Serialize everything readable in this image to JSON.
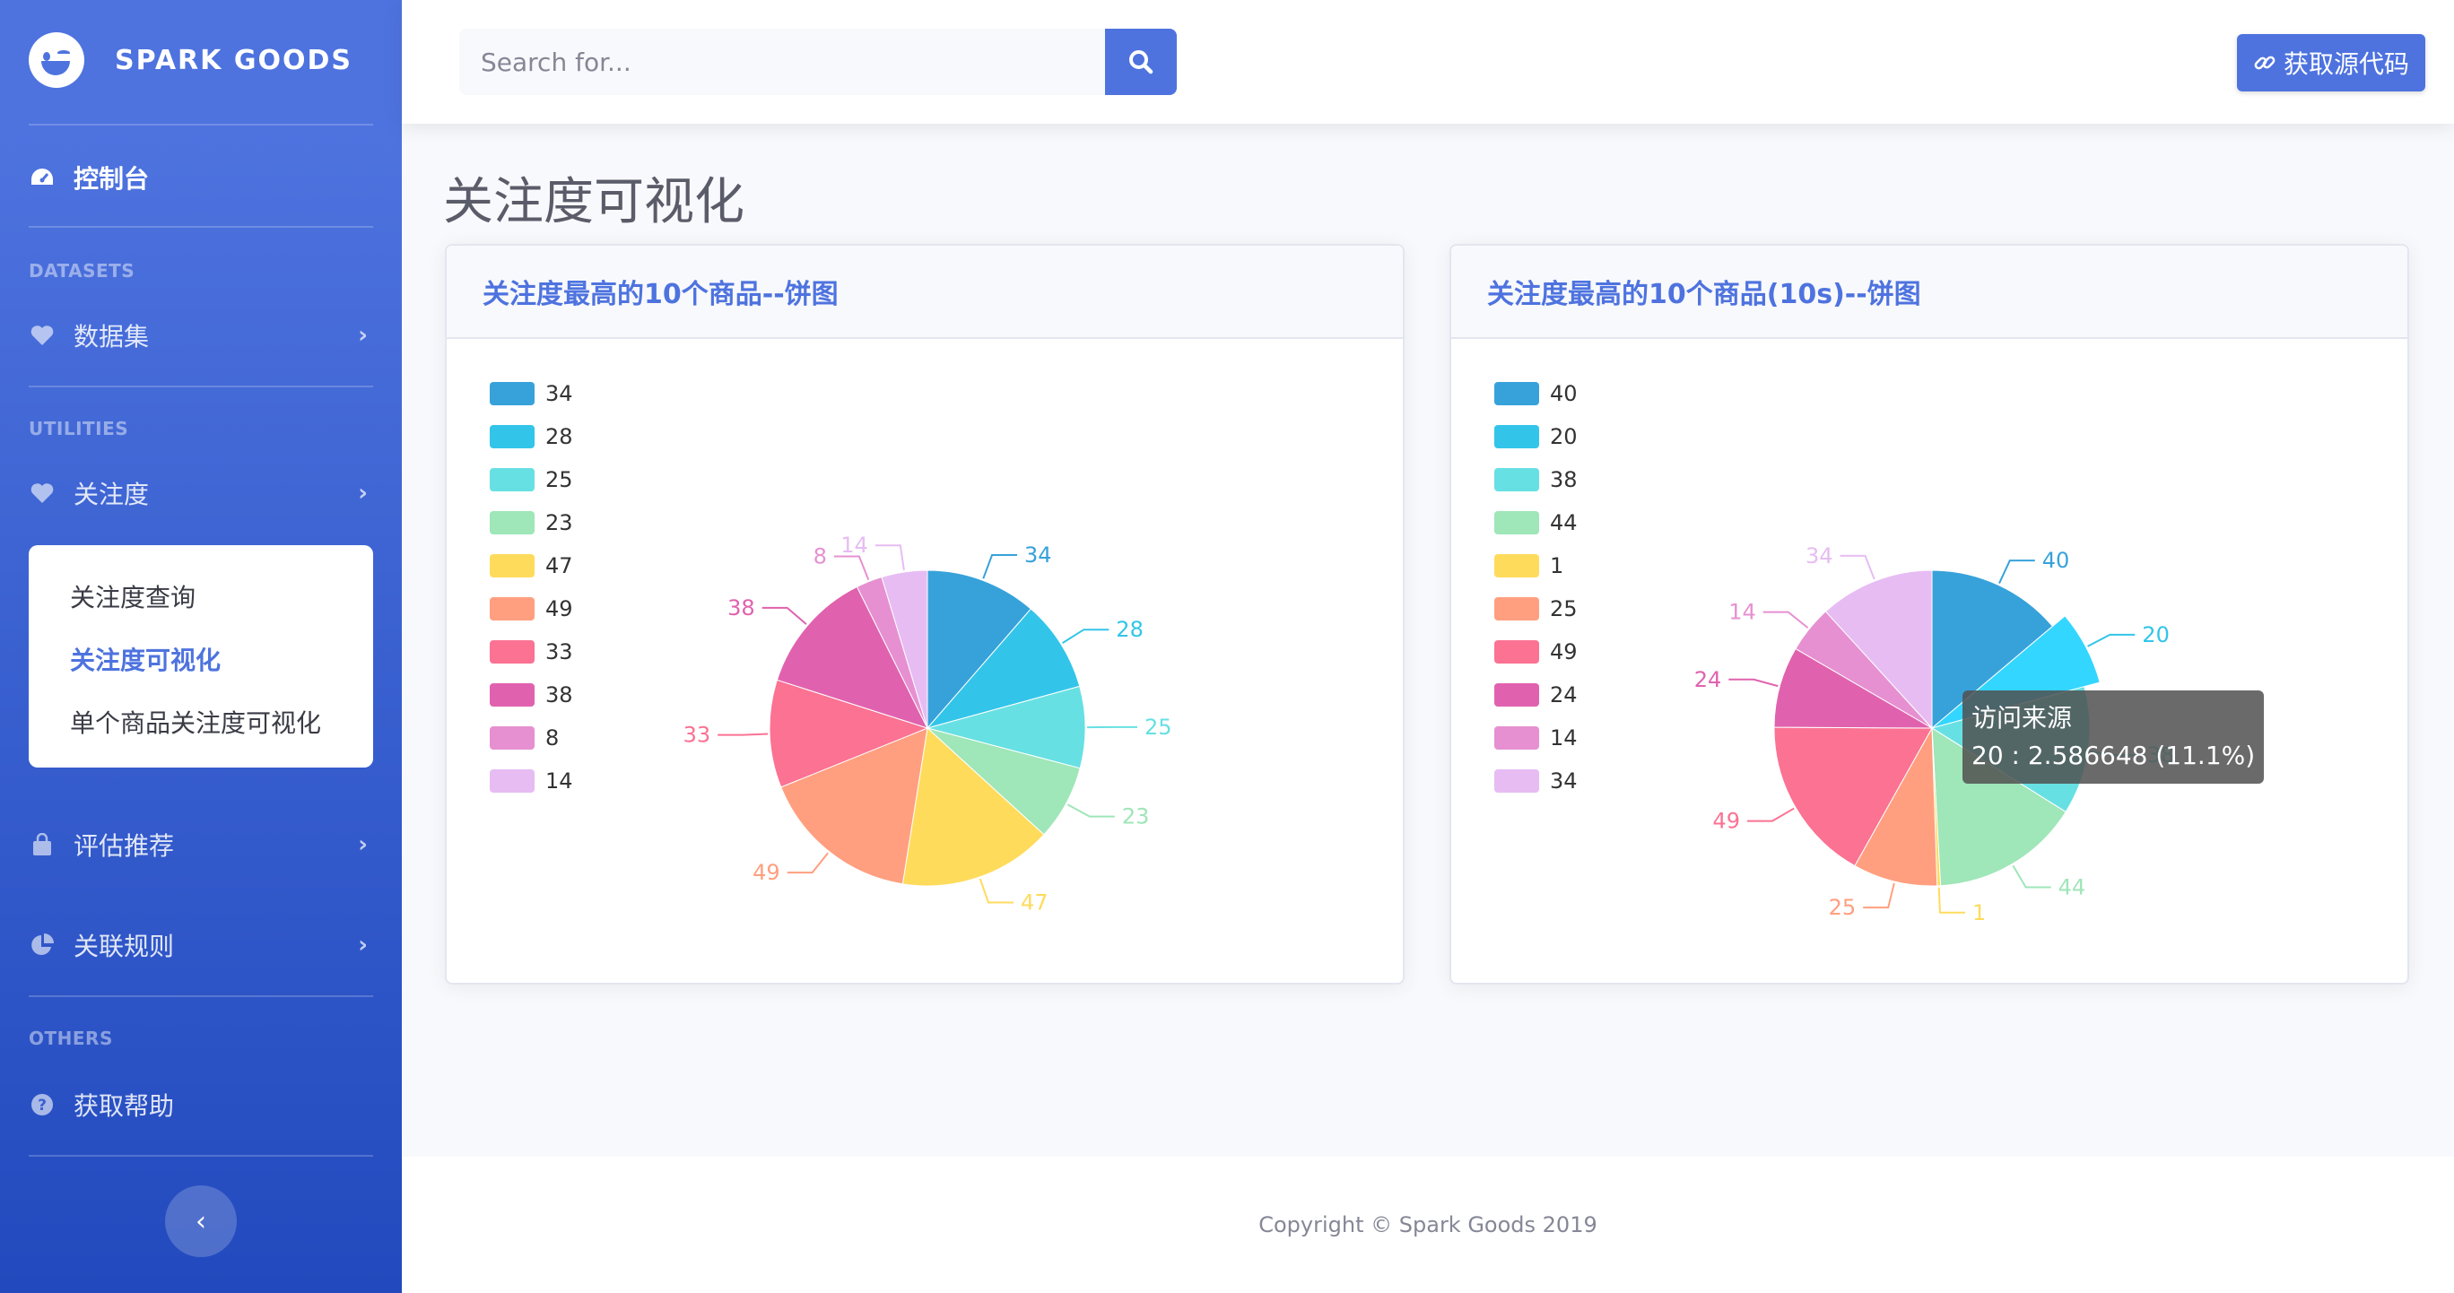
{
  "brand": {
    "name": "SPARK GOODS"
  },
  "sidebar": {
    "dashboard": "控制台",
    "heading_datasets": "DATASETS",
    "datasets": "数据集",
    "heading_utilities": "UTILITIES",
    "attention": "关注度",
    "sub_items": [
      "关注度查询",
      "关注度可视化",
      "单个商品关注度可视化"
    ],
    "evaluate": "评估推荐",
    "rules": "关联规则",
    "heading_others": "OTHERS",
    "help": "获取帮助"
  },
  "topbar": {
    "search_placeholder": "Search for...",
    "get_code": "获取源代码"
  },
  "page": {
    "title": "关注度可视化"
  },
  "footer": {
    "text": "Copyright © Spark Goods 2019"
  },
  "colors": [
    "#37a2da",
    "#32c5e9",
    "#67e0e3",
    "#9fe6b8",
    "#ffdb5c",
    "#ff9f7f",
    "#fb7293",
    "#e062ae",
    "#e690d1",
    "#e7bcf3"
  ],
  "tooltip": {
    "title": "访问来源",
    "text": "20 : 2.586648 (11.1%)"
  },
  "chart_data": [
    {
      "type": "pie",
      "title": "关注度最高的10个商品--饼图",
      "categories": [
        "34",
        "28",
        "25",
        "23",
        "47",
        "49",
        "33",
        "38",
        "8",
        "14"
      ],
      "values": [
        34,
        28,
        25,
        23,
        47,
        49,
        33,
        38,
        8,
        14
      ],
      "legend": "left"
    },
    {
      "type": "pie",
      "title": "关注度最高的10个商品(10s)--饼图",
      "categories": [
        "40",
        "20",
        "38",
        "44",
        "1",
        "25",
        "49",
        "24",
        "14",
        "34"
      ],
      "values": [
        40,
        20,
        38,
        44,
        1,
        25,
        49,
        24,
        14,
        34
      ],
      "legend": "left",
      "highlighted": "20"
    }
  ]
}
